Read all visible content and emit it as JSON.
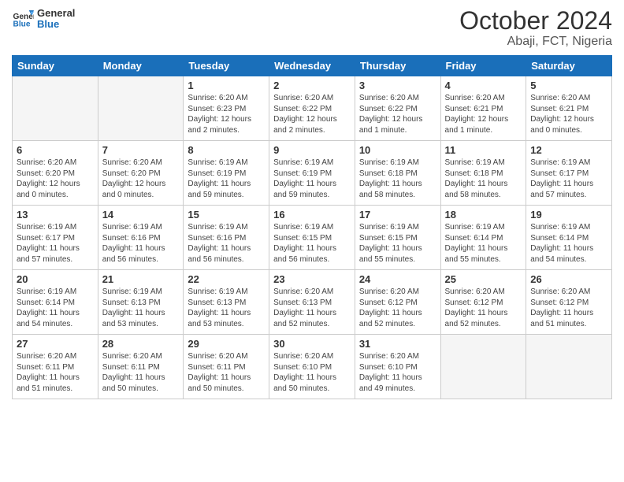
{
  "header": {
    "logo_text_general": "General",
    "logo_text_blue": "Blue",
    "month": "October 2024",
    "location": "Abaji, FCT, Nigeria"
  },
  "weekdays": [
    "Sunday",
    "Monday",
    "Tuesday",
    "Wednesday",
    "Thursday",
    "Friday",
    "Saturday"
  ],
  "weeks": [
    [
      {
        "day": "",
        "info": ""
      },
      {
        "day": "",
        "info": ""
      },
      {
        "day": "1",
        "info": "Sunrise: 6:20 AM\nSunset: 6:23 PM\nDaylight: 12 hours\nand 2 minutes."
      },
      {
        "day": "2",
        "info": "Sunrise: 6:20 AM\nSunset: 6:22 PM\nDaylight: 12 hours\nand 2 minutes."
      },
      {
        "day": "3",
        "info": "Sunrise: 6:20 AM\nSunset: 6:22 PM\nDaylight: 12 hours\nand 1 minute."
      },
      {
        "day": "4",
        "info": "Sunrise: 6:20 AM\nSunset: 6:21 PM\nDaylight: 12 hours\nand 1 minute."
      },
      {
        "day": "5",
        "info": "Sunrise: 6:20 AM\nSunset: 6:21 PM\nDaylight: 12 hours\nand 0 minutes."
      }
    ],
    [
      {
        "day": "6",
        "info": "Sunrise: 6:20 AM\nSunset: 6:20 PM\nDaylight: 12 hours\nand 0 minutes."
      },
      {
        "day": "7",
        "info": "Sunrise: 6:20 AM\nSunset: 6:20 PM\nDaylight: 12 hours\nand 0 minutes."
      },
      {
        "day": "8",
        "info": "Sunrise: 6:19 AM\nSunset: 6:19 PM\nDaylight: 11 hours\nand 59 minutes."
      },
      {
        "day": "9",
        "info": "Sunrise: 6:19 AM\nSunset: 6:19 PM\nDaylight: 11 hours\nand 59 minutes."
      },
      {
        "day": "10",
        "info": "Sunrise: 6:19 AM\nSunset: 6:18 PM\nDaylight: 11 hours\nand 58 minutes."
      },
      {
        "day": "11",
        "info": "Sunrise: 6:19 AM\nSunset: 6:18 PM\nDaylight: 11 hours\nand 58 minutes."
      },
      {
        "day": "12",
        "info": "Sunrise: 6:19 AM\nSunset: 6:17 PM\nDaylight: 11 hours\nand 57 minutes."
      }
    ],
    [
      {
        "day": "13",
        "info": "Sunrise: 6:19 AM\nSunset: 6:17 PM\nDaylight: 11 hours\nand 57 minutes."
      },
      {
        "day": "14",
        "info": "Sunrise: 6:19 AM\nSunset: 6:16 PM\nDaylight: 11 hours\nand 56 minutes."
      },
      {
        "day": "15",
        "info": "Sunrise: 6:19 AM\nSunset: 6:16 PM\nDaylight: 11 hours\nand 56 minutes."
      },
      {
        "day": "16",
        "info": "Sunrise: 6:19 AM\nSunset: 6:15 PM\nDaylight: 11 hours\nand 56 minutes."
      },
      {
        "day": "17",
        "info": "Sunrise: 6:19 AM\nSunset: 6:15 PM\nDaylight: 11 hours\nand 55 minutes."
      },
      {
        "day": "18",
        "info": "Sunrise: 6:19 AM\nSunset: 6:14 PM\nDaylight: 11 hours\nand 55 minutes."
      },
      {
        "day": "19",
        "info": "Sunrise: 6:19 AM\nSunset: 6:14 PM\nDaylight: 11 hours\nand 54 minutes."
      }
    ],
    [
      {
        "day": "20",
        "info": "Sunrise: 6:19 AM\nSunset: 6:14 PM\nDaylight: 11 hours\nand 54 minutes."
      },
      {
        "day": "21",
        "info": "Sunrise: 6:19 AM\nSunset: 6:13 PM\nDaylight: 11 hours\nand 53 minutes."
      },
      {
        "day": "22",
        "info": "Sunrise: 6:19 AM\nSunset: 6:13 PM\nDaylight: 11 hours\nand 53 minutes."
      },
      {
        "day": "23",
        "info": "Sunrise: 6:20 AM\nSunset: 6:13 PM\nDaylight: 11 hours\nand 52 minutes."
      },
      {
        "day": "24",
        "info": "Sunrise: 6:20 AM\nSunset: 6:12 PM\nDaylight: 11 hours\nand 52 minutes."
      },
      {
        "day": "25",
        "info": "Sunrise: 6:20 AM\nSunset: 6:12 PM\nDaylight: 11 hours\nand 52 minutes."
      },
      {
        "day": "26",
        "info": "Sunrise: 6:20 AM\nSunset: 6:12 PM\nDaylight: 11 hours\nand 51 minutes."
      }
    ],
    [
      {
        "day": "27",
        "info": "Sunrise: 6:20 AM\nSunset: 6:11 PM\nDaylight: 11 hours\nand 51 minutes."
      },
      {
        "day": "28",
        "info": "Sunrise: 6:20 AM\nSunset: 6:11 PM\nDaylight: 11 hours\nand 50 minutes."
      },
      {
        "day": "29",
        "info": "Sunrise: 6:20 AM\nSunset: 6:11 PM\nDaylight: 11 hours\nand 50 minutes."
      },
      {
        "day": "30",
        "info": "Sunrise: 6:20 AM\nSunset: 6:10 PM\nDaylight: 11 hours\nand 50 minutes."
      },
      {
        "day": "31",
        "info": "Sunrise: 6:20 AM\nSunset: 6:10 PM\nDaylight: 11 hours\nand 49 minutes."
      },
      {
        "day": "",
        "info": ""
      },
      {
        "day": "",
        "info": ""
      }
    ]
  ]
}
